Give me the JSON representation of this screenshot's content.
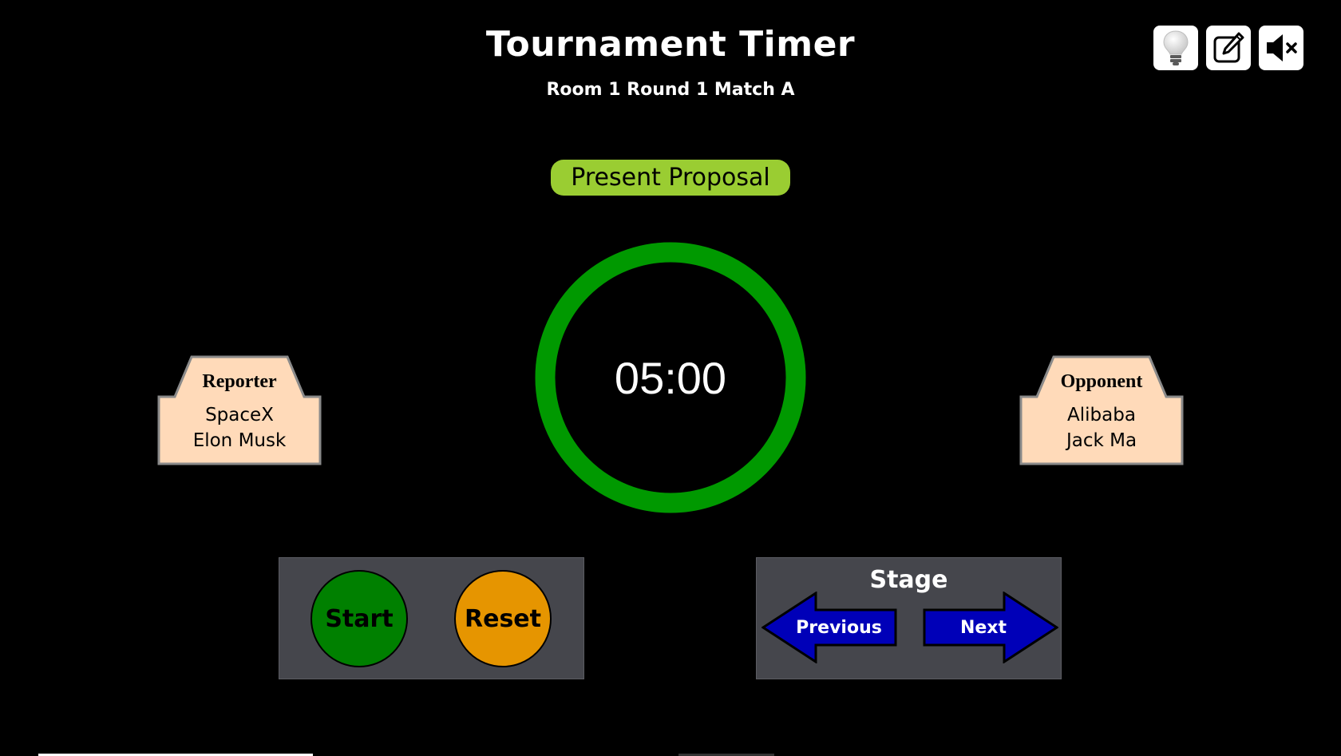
{
  "header": {
    "title": "Tournament Timer",
    "subtitle": "Room 1 Round 1 Match A"
  },
  "toolbar": {
    "items": [
      {
        "name": "lightbulb-icon",
        "label": "hint"
      },
      {
        "name": "edit-icon",
        "label": "edit"
      },
      {
        "name": "mute-icon",
        "label": "mute"
      }
    ]
  },
  "stage": {
    "current": "Present Proposal",
    "color": "#9acd32"
  },
  "timer": {
    "display": "05:00",
    "progress": 1.0,
    "ring_color": "#009900"
  },
  "reporter": {
    "role": "Reporter",
    "team": "SpaceX",
    "person": "Elon Musk",
    "color": "#ffdab9"
  },
  "opponent": {
    "role": "Opponent",
    "team": "Alibaba",
    "person": "Jack Ma",
    "color": "#ffdab9"
  },
  "controls": {
    "start_label": "Start",
    "start_color": "#008000",
    "reset_label": "Reset",
    "reset_color": "#e69500"
  },
  "stage_nav": {
    "title": "Stage",
    "previous_label": "Previous",
    "next_label": "Next",
    "arrow_color": "#0000b8"
  }
}
